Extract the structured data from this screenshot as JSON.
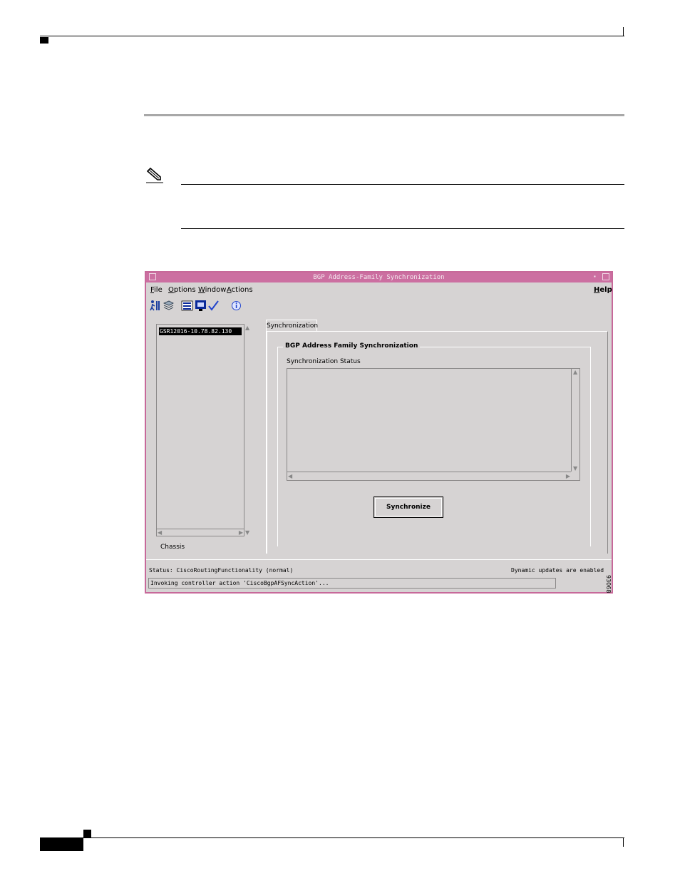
{
  "window": {
    "title": "BGP Address-Family Synchronization"
  },
  "menubar": {
    "items": [
      {
        "underline": "F",
        "rest": "ile"
      },
      {
        "underline": "O",
        "rest": "ptions"
      },
      {
        "underline": "W",
        "rest": "indow"
      },
      {
        "underline": "A",
        "rest": "ctions"
      }
    ],
    "help": {
      "underline": "H",
      "rest": "elp"
    }
  },
  "toolbar": {
    "icons": [
      "run-icon",
      "layers-icon",
      "list-icon",
      "monitor-icon",
      "check-icon",
      "info-icon"
    ]
  },
  "left_panel": {
    "selected_item": "GSR12016-10.78.82.130",
    "label": "Chassis"
  },
  "tab": {
    "label": "Synchronization"
  },
  "group": {
    "title": "BGP Address Family Synchronization",
    "status_label": "Synchronization Status",
    "button_label": "Synchronize"
  },
  "status_bar": {
    "status": "Status: CiscoRoutingFunctionality (normal)",
    "dynamic": "Dynamic updates are enabled",
    "message": "Invoking controller action 'CiscoBgpAFSyncAction'..."
  },
  "figure_id": "93068",
  "colors": {
    "titlebar": "#cc6fa1",
    "window_bg": "#d6d3d3"
  }
}
